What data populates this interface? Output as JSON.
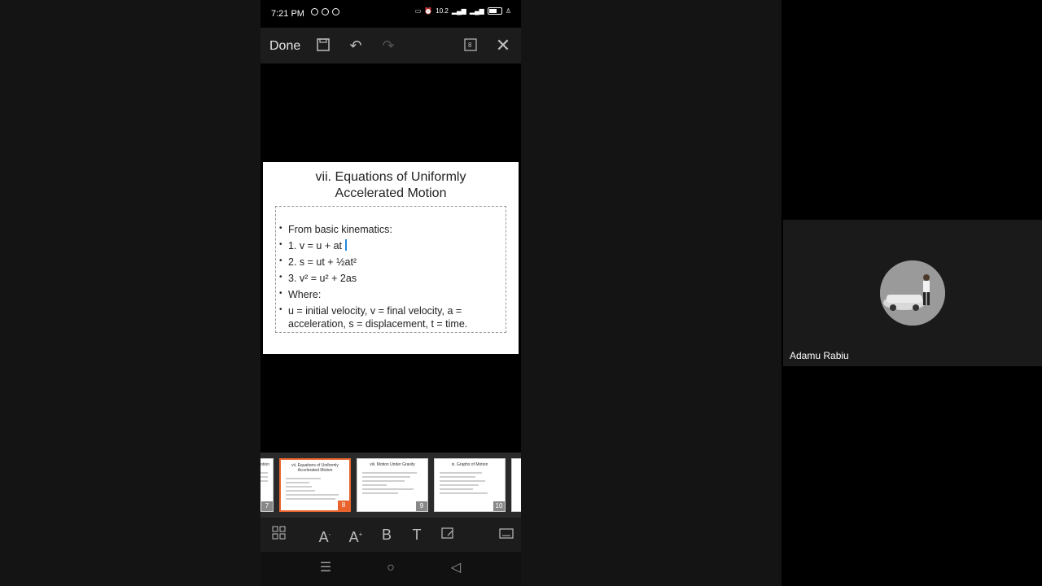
{
  "status": {
    "time": "7:21 PM",
    "net_speed": "10.2"
  },
  "toolbar": {
    "done_label": "Done",
    "page_badge": "8"
  },
  "slide": {
    "title_line1": "vii. Equations of Uniformly",
    "title_line2": "Accelerated Motion",
    "bullets": [
      "From basic kinematics:",
      "1. v = u + at",
      "2. s = ut + ½at²",
      "3. v² = u² + 2as",
      "Where:",
      "u = initial velocity, v = final velocity, a = acceleration, s = displacement, t = time."
    ]
  },
  "thumbnails": [
    {
      "title": "vii. Equations of Uniformly Accelerated Motion",
      "number": "8"
    },
    {
      "title": "viii. Motion Under Gravity",
      "number": "9"
    },
    {
      "title": "ix. Graphs of Motion",
      "number": "10"
    }
  ],
  "partial_thumb": {
    "title": "otion",
    "number": "7"
  },
  "participant": {
    "name": "Adamu Rabiu"
  },
  "colors": {
    "accent": "#e8642c",
    "cursor": "#1e88e5"
  }
}
